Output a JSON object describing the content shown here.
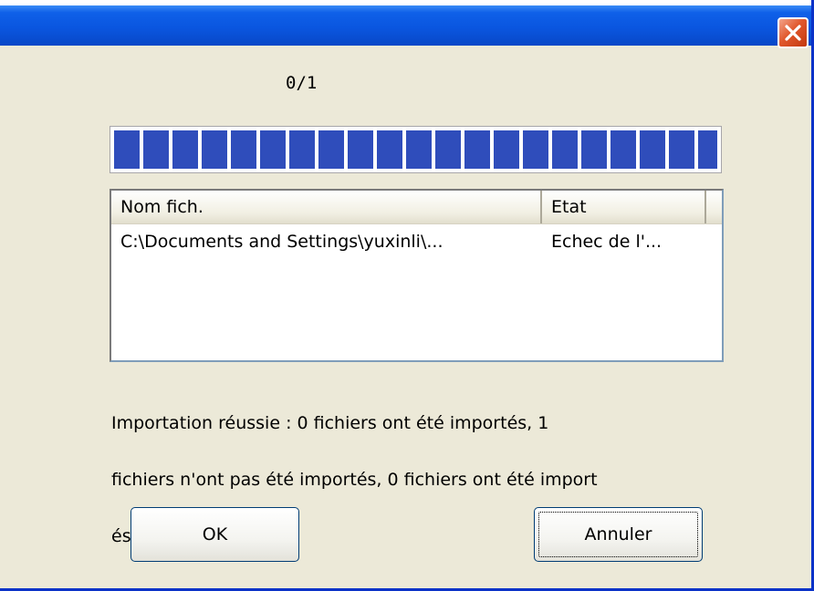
{
  "dialog": {
    "title": "",
    "counter": "0/1",
    "progress": {
      "fraction": 1.0,
      "segment_color": "#2f4dbb"
    },
    "list": {
      "columns": [
        "Nom fich.",
        "Etat"
      ],
      "rows": [
        {
          "name": "C:\\Documents and Settings\\yuxinli\\...",
          "status": "Echec de l'..."
        }
      ]
    },
    "message_line1": "Importation réussie : 0 fichiers ont été importés, 1",
    "message_line2": "fichiers n'ont pas été importés, 0 fichiers ont été import",
    "message_line3": "és deux fois.",
    "buttons": {
      "ok_label": "OK",
      "cancel_label": "Annuler"
    },
    "icons": {
      "close": "close-icon"
    }
  }
}
